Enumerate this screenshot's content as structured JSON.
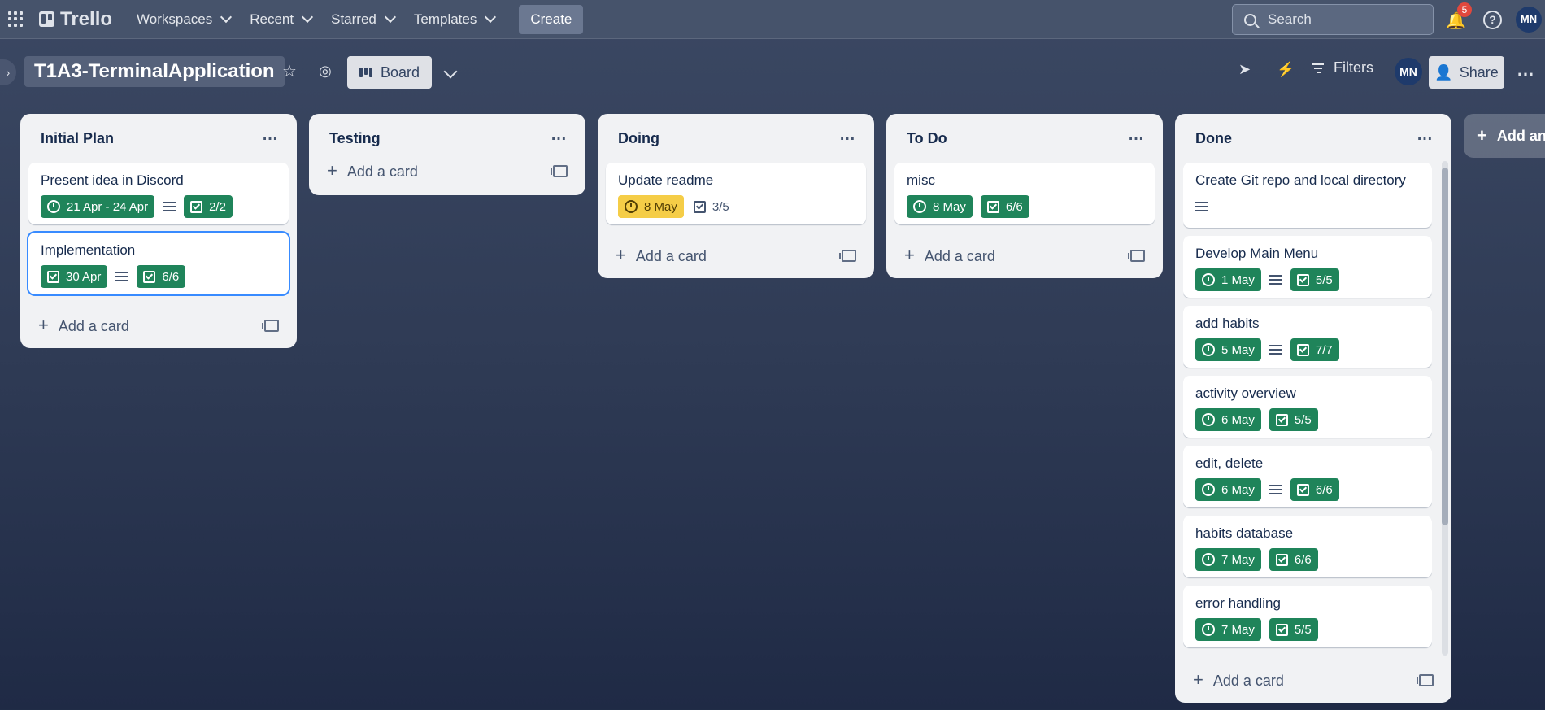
{
  "nav": {
    "logo": "Trello",
    "items": [
      {
        "label": "Workspaces"
      },
      {
        "label": "Recent"
      },
      {
        "label": "Starred"
      },
      {
        "label": "Templates"
      }
    ],
    "create": "Create",
    "search_placeholder": "Search",
    "notifications_count": "5",
    "avatar": "MN"
  },
  "board": {
    "title": "T1A3-TerminalApplication",
    "view": "Board",
    "filters": "Filters",
    "avatar": "MN",
    "share": "Share"
  },
  "lists": [
    {
      "title": "Initial Plan",
      "cards": [
        {
          "title": "Present idea in Discord",
          "date": "21 Apr - 24 Apr",
          "description": true,
          "checklist": "2/2"
        },
        {
          "title": "Implementation",
          "date": "30 Apr",
          "description": true,
          "checklist": "6/6"
        }
      ],
      "add_card": "Add a card"
    },
    {
      "title": "Testing",
      "cards": [],
      "add_card": "Add a card"
    },
    {
      "title": "Doing",
      "cards": [
        {
          "title": "Update readme",
          "date": "8 May",
          "checklist": "3/5"
        }
      ],
      "add_card": "Add a card"
    },
    {
      "title": "To Do",
      "cards": [
        {
          "title": "misc",
          "date": "8 May",
          "checklist": "6/6"
        }
      ],
      "add_card": "Add a card"
    },
    {
      "title": "Done",
      "cards": [
        {
          "title": "Create Git repo and local directory",
          "description": true
        },
        {
          "title": "Develop Main Menu",
          "date": "1 May",
          "description": true,
          "checklist": "5/5"
        },
        {
          "title": "add habits",
          "date": "5 May",
          "description": true,
          "checklist": "7/7"
        },
        {
          "title": "activity overview",
          "date": "6 May",
          "checklist": "5/5"
        },
        {
          "title": "edit, delete",
          "date": "6 May",
          "description": true,
          "checklist": "6/6"
        },
        {
          "title": "habits database",
          "date": "7 May",
          "checklist": "6/6"
        },
        {
          "title": "error handling",
          "date": "7 May",
          "checklist": "5/5"
        }
      ],
      "add_card": "Add a card"
    }
  ],
  "add_list": "Add an"
}
